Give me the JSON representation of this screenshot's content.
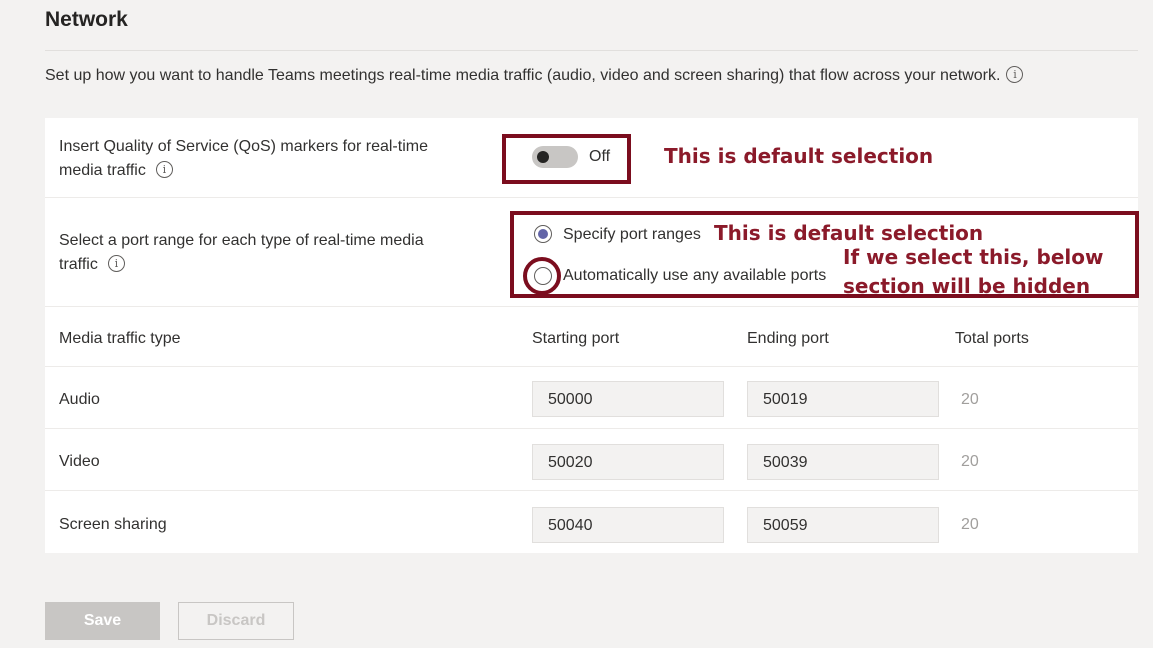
{
  "header": {
    "title": "Network",
    "description": "Set up how you want to handle Teams meetings real-time media traffic (audio, video and screen sharing) that flow across your network.",
    "info_icon": "i"
  },
  "qos": {
    "label_line1": "Insert Quality of Service (QoS) markers for real-time",
    "label_line2": "media traffic",
    "toggle_state": "Off",
    "toggle_on": false
  },
  "port_range": {
    "label_line1": "Select a port range for each type of real-time media",
    "label_line2": "traffic",
    "options": [
      {
        "label": "Specify port ranges",
        "selected": true
      },
      {
        "label": "Automatically use any available ports",
        "selected": false
      }
    ]
  },
  "annotations": {
    "qos_note": "This is default selection",
    "port_note": "This is default selection",
    "auto_note_line1": "If we select this, below",
    "auto_note_line2": "section will be hidden",
    "color": "#7b0d1e"
  },
  "table": {
    "headers": [
      "Media traffic type",
      "Starting port",
      "Ending port",
      "Total ports"
    ],
    "rows": [
      {
        "type": "Audio",
        "start": "50000",
        "end": "50019",
        "total": "20"
      },
      {
        "type": "Video",
        "start": "50020",
        "end": "50039",
        "total": "20"
      },
      {
        "type": "Screen sharing",
        "start": "50040",
        "end": "50059",
        "total": "20"
      }
    ]
  },
  "buttons": {
    "save": "Save",
    "discard": "Discard"
  },
  "colors": {
    "accent": "#6264a7",
    "page_bg": "#f3f2f1",
    "card_bg": "#ffffff"
  }
}
